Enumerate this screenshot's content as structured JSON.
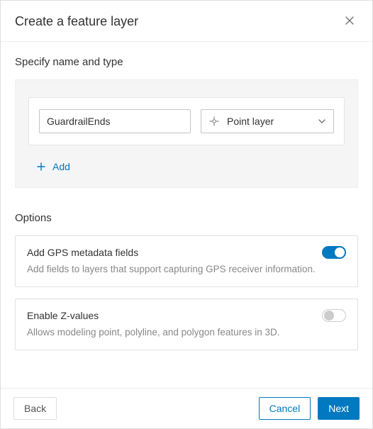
{
  "dialog": {
    "title": "Create a feature layer"
  },
  "specify": {
    "heading": "Specify name and type",
    "name_value": "GuardrailEnds",
    "type_selected": "Point layer",
    "add_label": "Add"
  },
  "options": {
    "heading": "Options",
    "gps": {
      "title": "Add GPS metadata fields",
      "desc": "Add fields to layers that support capturing GPS receiver information.",
      "state": "on"
    },
    "z": {
      "title": "Enable Z-values",
      "desc": "Allows modeling point, polyline, and polygon features in 3D.",
      "state": "off"
    }
  },
  "footer": {
    "back": "Back",
    "cancel": "Cancel",
    "next": "Next"
  }
}
